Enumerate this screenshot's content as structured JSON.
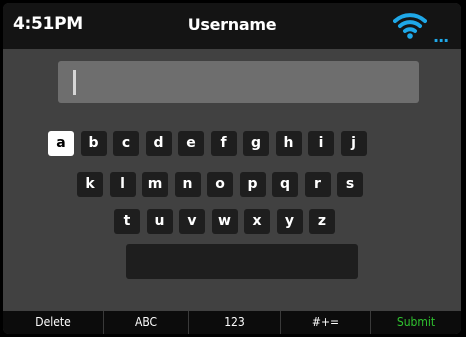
{
  "status": {
    "time": "4:51PM",
    "title": "Username",
    "more": "..."
  },
  "input": {
    "value": ""
  },
  "keyboard": {
    "row1": [
      "a",
      "b",
      "c",
      "d",
      "e",
      "f",
      "g",
      "h",
      "i",
      "j"
    ],
    "row2": [
      "k",
      "l",
      "m",
      "n",
      "o",
      "p",
      "q",
      "r",
      "s"
    ],
    "row3": [
      "t",
      "u",
      "v",
      "w",
      "x",
      "y",
      "z"
    ],
    "selected": "a"
  },
  "softkeys": [
    "Delete",
    "ABC",
    "123",
    "#+=",
    "Submit"
  ],
  "colors": {
    "wifi": "#1fa8e8",
    "submit": "#2fc12f",
    "selected_key": "#ffffff"
  },
  "icons": {
    "wifi": "wifi-icon",
    "more": "more-dots-icon"
  }
}
